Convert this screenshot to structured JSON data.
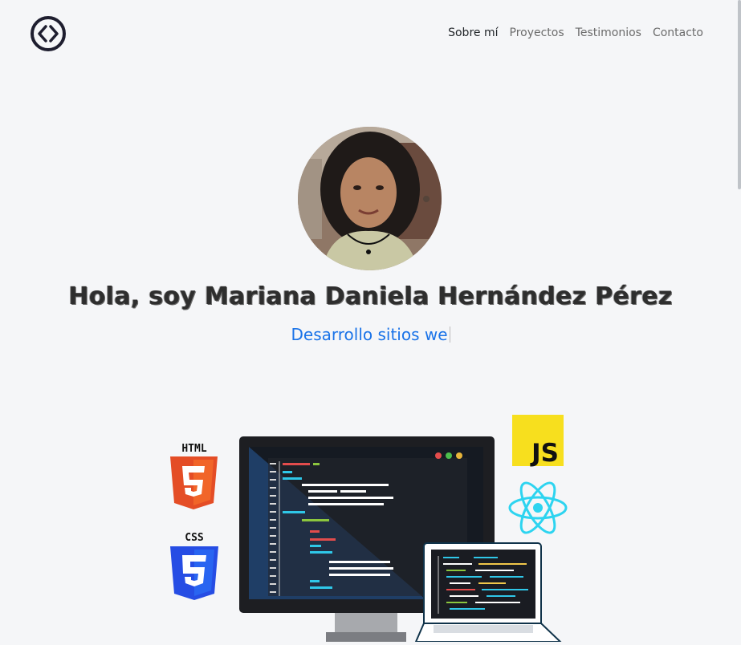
{
  "header": {
    "logo_icon": "code-brackets-icon",
    "nav": [
      {
        "label": "Sobre mí",
        "active": true
      },
      {
        "label": "Proyectos",
        "active": false
      },
      {
        "label": "Testimonios",
        "active": false
      },
      {
        "label": "Contacto",
        "active": false
      }
    ]
  },
  "hero": {
    "title": "Hola, soy Mariana Daniela Hernández Pérez",
    "typed_text": "Desarrollo sitios we",
    "photo_icon": "profile-photo"
  },
  "illustration": {
    "html_label": "HTML",
    "css_label": "CSS",
    "js_label": "JS",
    "colors": {
      "html": "#e44d26",
      "css": "#264de4",
      "js": "#f7df1e",
      "react": "#2dd4f0",
      "link": "#1a73e8"
    }
  }
}
